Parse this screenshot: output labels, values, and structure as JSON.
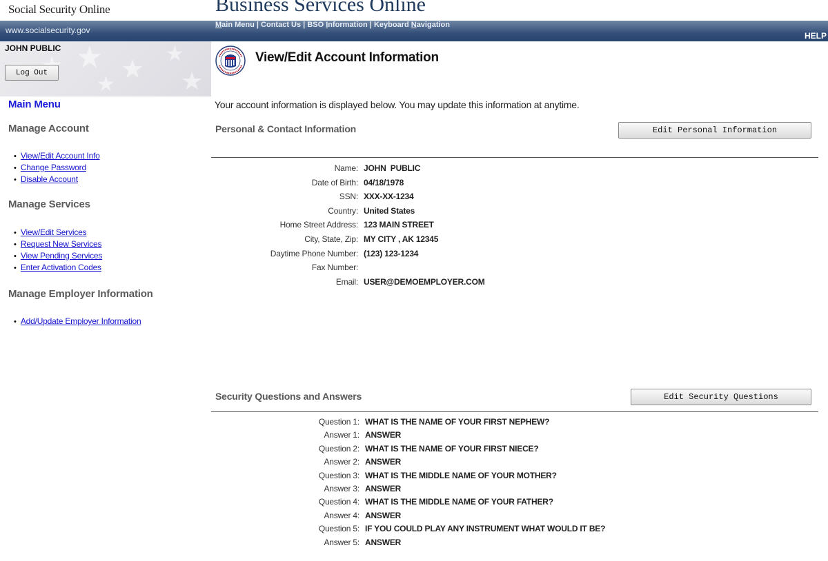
{
  "header": {
    "brand": "Social Security Online",
    "site_title": "Business Services Online",
    "url": "www.socialsecurity.gov",
    "nav": [
      "Main Menu",
      "Contact Us",
      "BSO Information",
      "Keyboard Navigation"
    ],
    "nav_separator": " | ",
    "help": "HELP"
  },
  "sidebar": {
    "user_name": "JOHN PUBLIC",
    "logout_label": "Log Out",
    "main_menu": "Main Menu",
    "sections": [
      {
        "title": "Manage Account",
        "items": [
          "View/Edit Account Info",
          "Change Password",
          "Disable Account"
        ]
      },
      {
        "title": "Manage Services",
        "items": [
          "View/Edit Services",
          "Request New Services",
          "View Pending Services",
          "Enter Activation Codes"
        ]
      },
      {
        "title": "Manage Employer Information",
        "items": [
          "Add/Update Employer Information"
        ]
      }
    ]
  },
  "main": {
    "title": "View/Edit Account Information",
    "intro": "Your account information is displayed below. You may update this information at anytime.",
    "personal": {
      "heading": "Personal & Contact Information",
      "edit_label": "Edit Personal Information",
      "fields": [
        {
          "label": "Name:",
          "value": "JOHN  PUBLIC"
        },
        {
          "label": "Date of Birth:",
          "value": "04/18/1978"
        },
        {
          "label": "SSN:",
          "value": "XXX-XX-1234"
        },
        {
          "label": "Country:",
          "value": "United States"
        },
        {
          "label": "Home Street Address:",
          "value": "123 MAIN STREET"
        },
        {
          "label": "City, State, Zip:",
          "value": "MY CITY , AK 12345"
        },
        {
          "label": "Daytime Phone Number:",
          "value": "(123) 123-1234"
        },
        {
          "label": "Fax Number:",
          "value": ""
        },
        {
          "label": "Email:",
          "value": "USER@DEMOEMPLOYER.COM"
        }
      ]
    },
    "security": {
      "heading": "Security Questions and Answers",
      "edit_label": "Edit Security Questions",
      "fields": [
        {
          "label": "Question 1:",
          "value": "WHAT IS THE NAME OF YOUR FIRST NEPHEW?"
        },
        {
          "label": "Answer 1:",
          "value": "ANSWER"
        },
        {
          "label": "Question 2:",
          "value": "WHAT IS THE NAME OF YOUR FIRST NIECE?"
        },
        {
          "label": "Answer 2:",
          "value": "ANSWER"
        },
        {
          "label": "Question 3:",
          "value": "WHAT IS THE MIDDLE NAME OF YOUR MOTHER?"
        },
        {
          "label": "Answer 3:",
          "value": "ANSWER"
        },
        {
          "label": "Question 4:",
          "value": "WHAT IS THE MIDDLE NAME OF YOUR FATHER?"
        },
        {
          "label": "Answer 4:",
          "value": "ANSWER"
        },
        {
          "label": "Question 5:",
          "value": "IF YOU COULD PLAY ANY INSTRUMENT WHAT WOULD IT BE?"
        },
        {
          "label": "Answer 5:",
          "value": "ANSWER"
        }
      ]
    }
  },
  "colors": {
    "header_bar": "#34507a",
    "link": "#1515d0",
    "main_menu": "#1a1ad8"
  }
}
